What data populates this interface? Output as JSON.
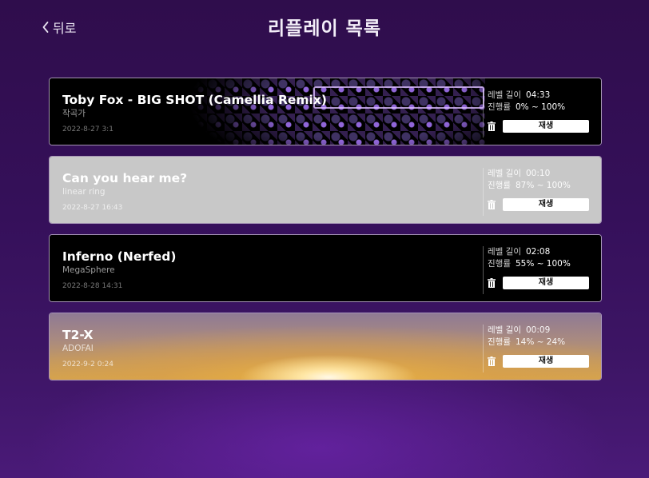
{
  "header": {
    "back_label": "뒤로",
    "title": "리플레이 목록"
  },
  "labels": {
    "length": "레벨 길이",
    "progress": "진행률",
    "play": "재생"
  },
  "replays": [
    {
      "song": "Toby Fox - BIG SHOT (Camellia Remix)",
      "artist": "작곡가",
      "date": "2022-8-27 3:1",
      "length": "04:33",
      "progress": "0% ~ 100%",
      "background": "pattern-dark"
    },
    {
      "song": "Can you hear me?",
      "artist": "linear ring",
      "date": "2022-8-27 16:43",
      "length": "00:10",
      "progress": "87% ~ 100%",
      "background": "gray"
    },
    {
      "song": "Inferno (Nerfed)",
      "artist": "MegaSphere",
      "date": "2022-8-28 14:31",
      "length": "02:08",
      "progress": "55% ~ 100%",
      "background": "black"
    },
    {
      "song": "T2-X",
      "artist": "ADOFAI",
      "date": "2022-9-2 0:24",
      "length": "00:09",
      "progress": "14% ~ 24%",
      "background": "sunset"
    }
  ],
  "icons": {
    "back": "chevron-left-icon",
    "delete": "trash-icon"
  }
}
